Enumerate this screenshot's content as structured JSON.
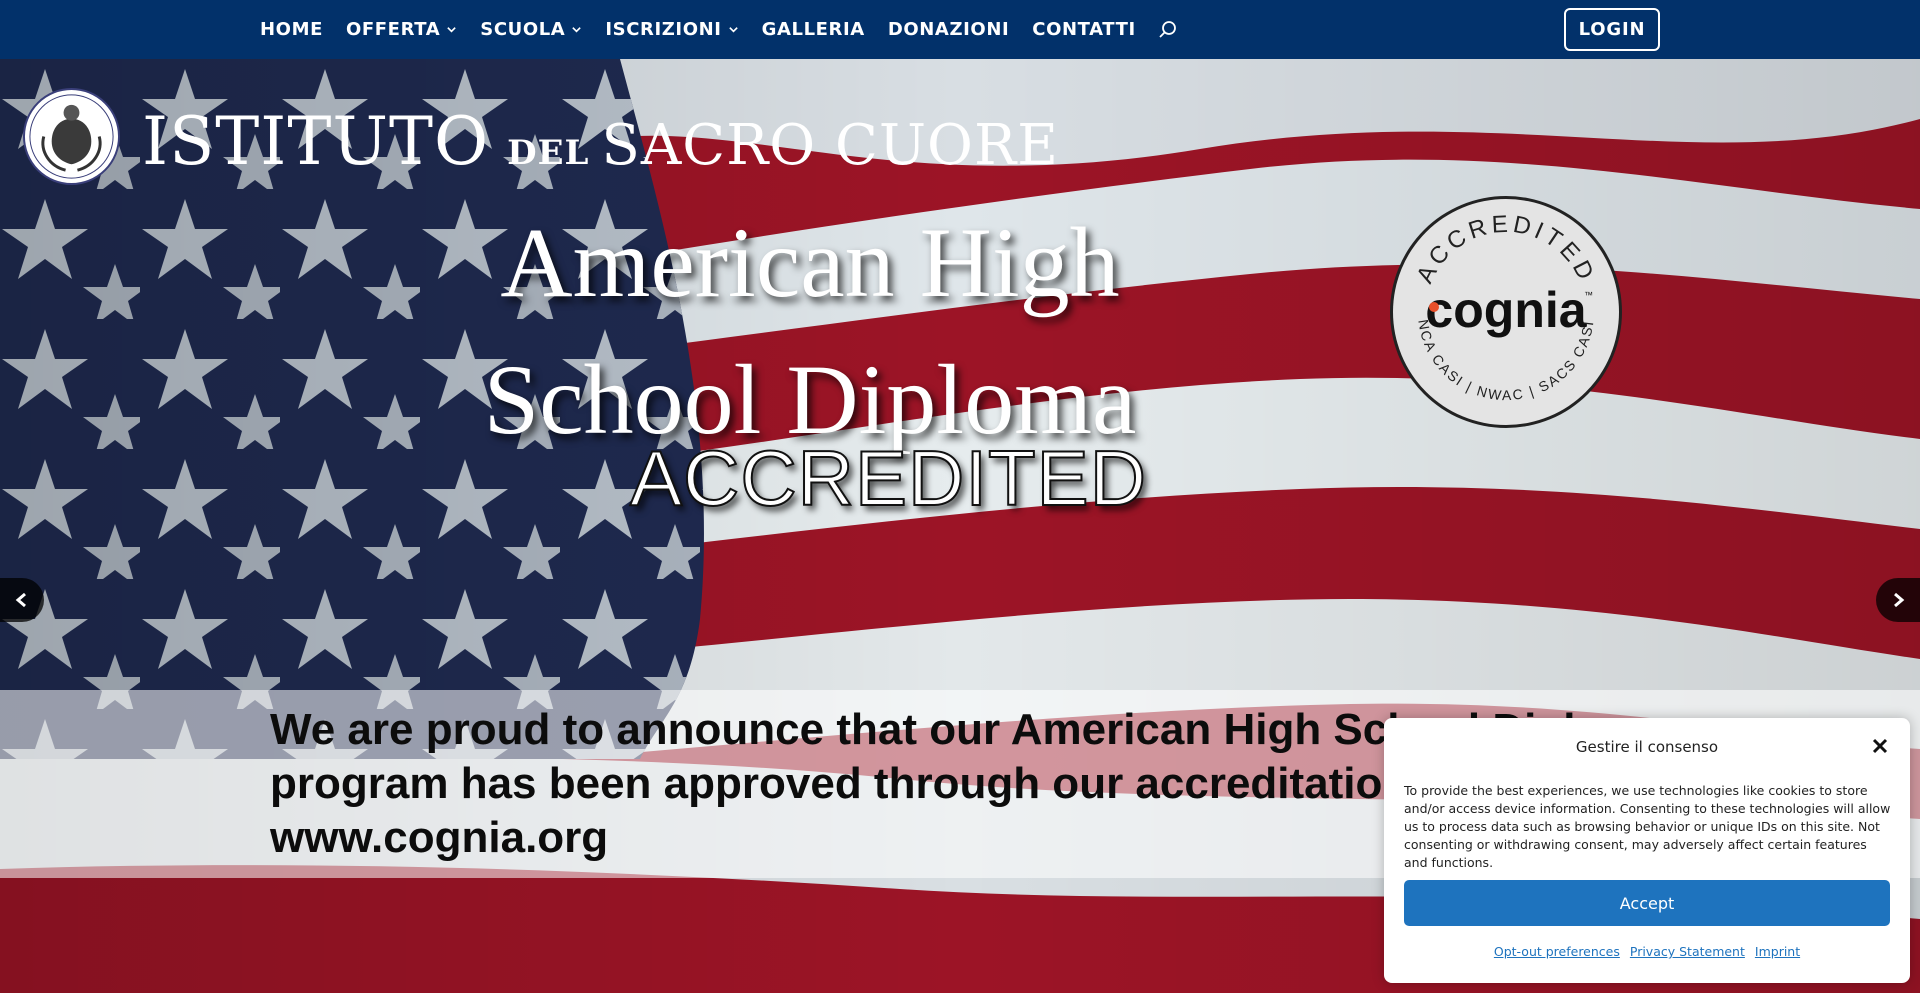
{
  "nav": {
    "items": [
      {
        "label": "HOME",
        "has_dropdown": false
      },
      {
        "label": "OFFERTA",
        "has_dropdown": true
      },
      {
        "label": "SCUOLA",
        "has_dropdown": true
      },
      {
        "label": "ISCRIZIONI",
        "has_dropdown": true
      },
      {
        "label": "GALLERIA",
        "has_dropdown": false
      },
      {
        "label": "DONAZIONI",
        "has_dropdown": false
      },
      {
        "label": "CONTATTI",
        "has_dropdown": false
      }
    ],
    "search_icon": "search-icon",
    "login_label": "LOGIN"
  },
  "brand": {
    "word1": "ISTITUTO",
    "word2": "DEL",
    "word3": "SACRO CUORE"
  },
  "hero": {
    "title_line1": "American High",
    "title_line2": "School Diploma",
    "subtitle": "ACCREDITED",
    "seal": {
      "top_text": "ACCREDITED",
      "brand": "cognia",
      "trademark": "™",
      "bottom_text": "NCA CASI | NWAC | SACS CASI"
    },
    "announcement": "We are proud to announce that our American High School Diploma program has been approved through our accreditation by www.cognia.org"
  },
  "consent": {
    "title": "Gestire il consenso",
    "body": "To provide the best experiences, we use technologies like cookies to store and/or access device information. Consenting to these technologies will allow us to process data such as browsing behavior or unique IDs on this site. Not consenting or withdrawing consent, may adversely affect certain features and functions.",
    "accept_label": "Accept",
    "links": [
      "Opt-out preferences",
      "Privacy Statement",
      "Imprint"
    ]
  },
  "colors": {
    "nav_bg": "#02316a",
    "accept_bg": "#1e73be",
    "flag_red": "#a3182a",
    "flag_blue": "#1e2a52"
  }
}
